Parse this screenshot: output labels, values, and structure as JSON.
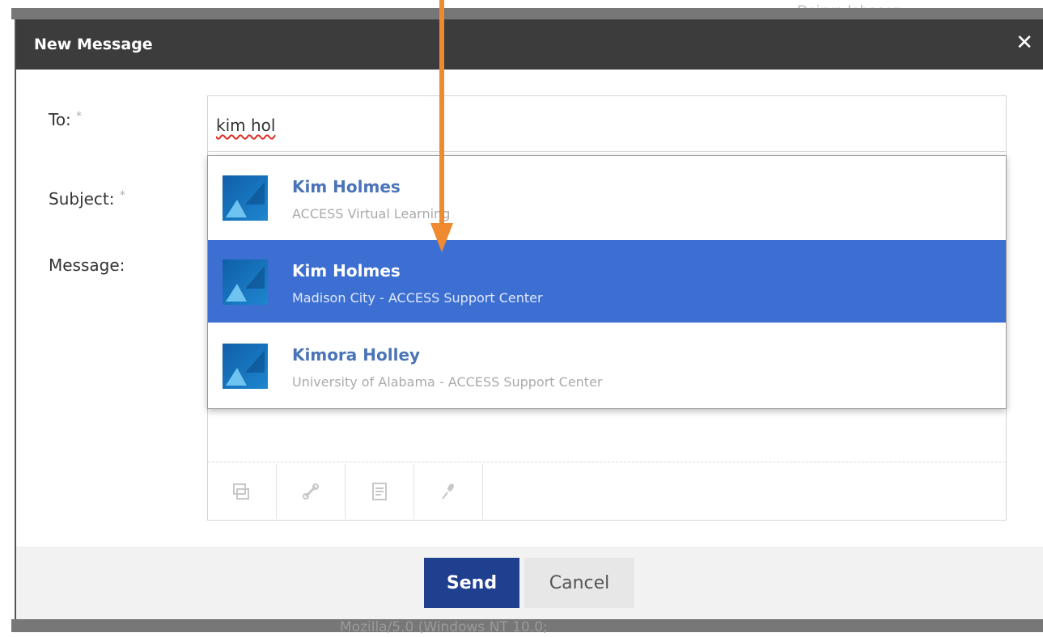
{
  "background": {
    "top_text": ", . , , , , , . , , . ,  , , ,",
    "user_name": "Deirun Johnson",
    "footer_text": "Mozilla/5.0 (Windows NT 10.0;"
  },
  "modal": {
    "title": "New Message",
    "close_glyph": "✕",
    "labels": {
      "to": "To:",
      "subject": "Subject:",
      "message": "Message:",
      "required_mark": "*"
    },
    "to_value": "kim hol",
    "suggestions": [
      {
        "name": "Kim Holmes",
        "org": "ACCESS Virtual Learning",
        "selected": false
      },
      {
        "name": "Kim Holmes",
        "org": "Madison City - ACCESS Support Center",
        "selected": true
      },
      {
        "name": "Kimora Holley",
        "org": "University of Alabama - ACCESS Support Center",
        "selected": false
      }
    ],
    "toolbar_icons": [
      "video-icon",
      "link-icon",
      "document-icon",
      "microphone-icon"
    ],
    "send_label": "Send",
    "cancel_label": "Cancel"
  },
  "colors": {
    "header_bg": "#3c3c3c",
    "selected_row": "#3c6fd1",
    "send_button": "#1f3f8f",
    "annotation_arrow": "#f08a30"
  }
}
